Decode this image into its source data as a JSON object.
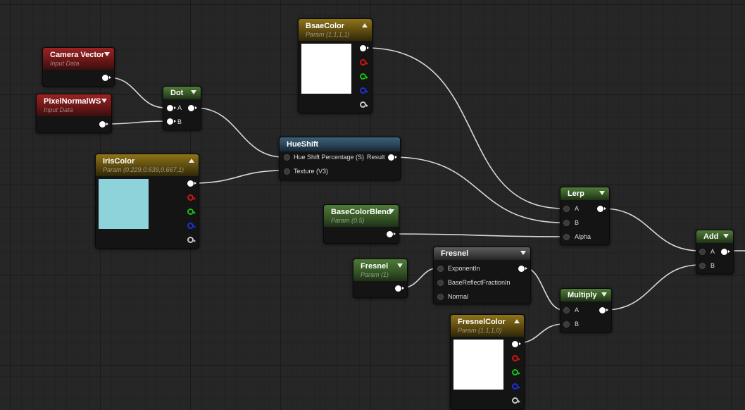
{
  "nodes": {
    "camera_vector": {
      "title": "Camera Vector",
      "subtitle": "Input Data"
    },
    "pixel_normal": {
      "title": "PixelNormalWS",
      "subtitle": "Input Data"
    },
    "dot": {
      "title": "Dot",
      "pin_a": "A",
      "pin_b": "B"
    },
    "bsae_color": {
      "title": "BsaeColor",
      "subtitle": "Param (1,1,1,1)",
      "swatch_color": "#ffffff"
    },
    "hue_shift": {
      "title": "HueShift",
      "pin_input1": "Hue Shift Percentage (S)",
      "pin_output": "Result",
      "pin_input2": "Texture (V3)"
    },
    "iris_color": {
      "title": "IrisColor",
      "subtitle": "Param (0.229,0.639,0.667,1)",
      "swatch_color": "#8ed3da"
    },
    "base_color_blend": {
      "title": "BaseColorBlend",
      "subtitle": "Param (0.5)"
    },
    "lerp": {
      "title": "Lerp",
      "pin_a": "A",
      "pin_b": "B",
      "pin_alpha": "Alpha"
    },
    "add": {
      "title": "Add",
      "pin_a": "A",
      "pin_b": "B"
    },
    "fresnel_param": {
      "title": "Fresnel",
      "subtitle": "Param (1)"
    },
    "fresnel_func": {
      "title": "Fresnel",
      "pin_exponent": "ExponentIn",
      "pin_base_reflect": "BaseReflectFractionIn",
      "pin_normal": "Normal"
    },
    "multiply": {
      "title": "Multiply",
      "pin_a": "A",
      "pin_b": "B"
    },
    "fresnel_color": {
      "title": "FresnelColor",
      "subtitle": "Param (1,1,1,0)",
      "swatch_color": "#ffffff"
    }
  },
  "colors": {
    "wire": "#d8d8d8",
    "pin_red": "#d01414",
    "pin_green": "#14c214",
    "pin_blue": "#1e2ed8",
    "pin_alpha": "#c8c8c8"
  }
}
